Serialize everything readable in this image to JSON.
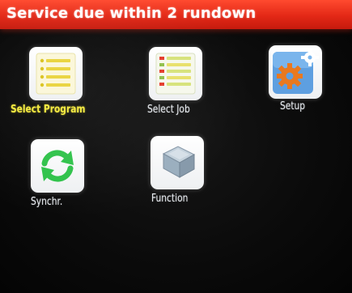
{
  "header": {
    "service_message": "Service due within 2 rundown",
    "bar_color": "#e32816"
  },
  "menu": {
    "selected_label_color": "#f5ea3a",
    "items": [
      {
        "label": "Select Program",
        "icon": "program-list-icon",
        "selected": true
      },
      {
        "label": "Select Job",
        "icon": "job-list-icon",
        "selected": false
      },
      {
        "label": "Setup",
        "icon": "setup-gears-icon",
        "selected": false
      },
      {
        "label": "Synchr.",
        "icon": "sync-arrows-icon",
        "selected": false
      },
      {
        "label": "Function",
        "icon": "function-box-icon",
        "selected": false
      }
    ]
  }
}
